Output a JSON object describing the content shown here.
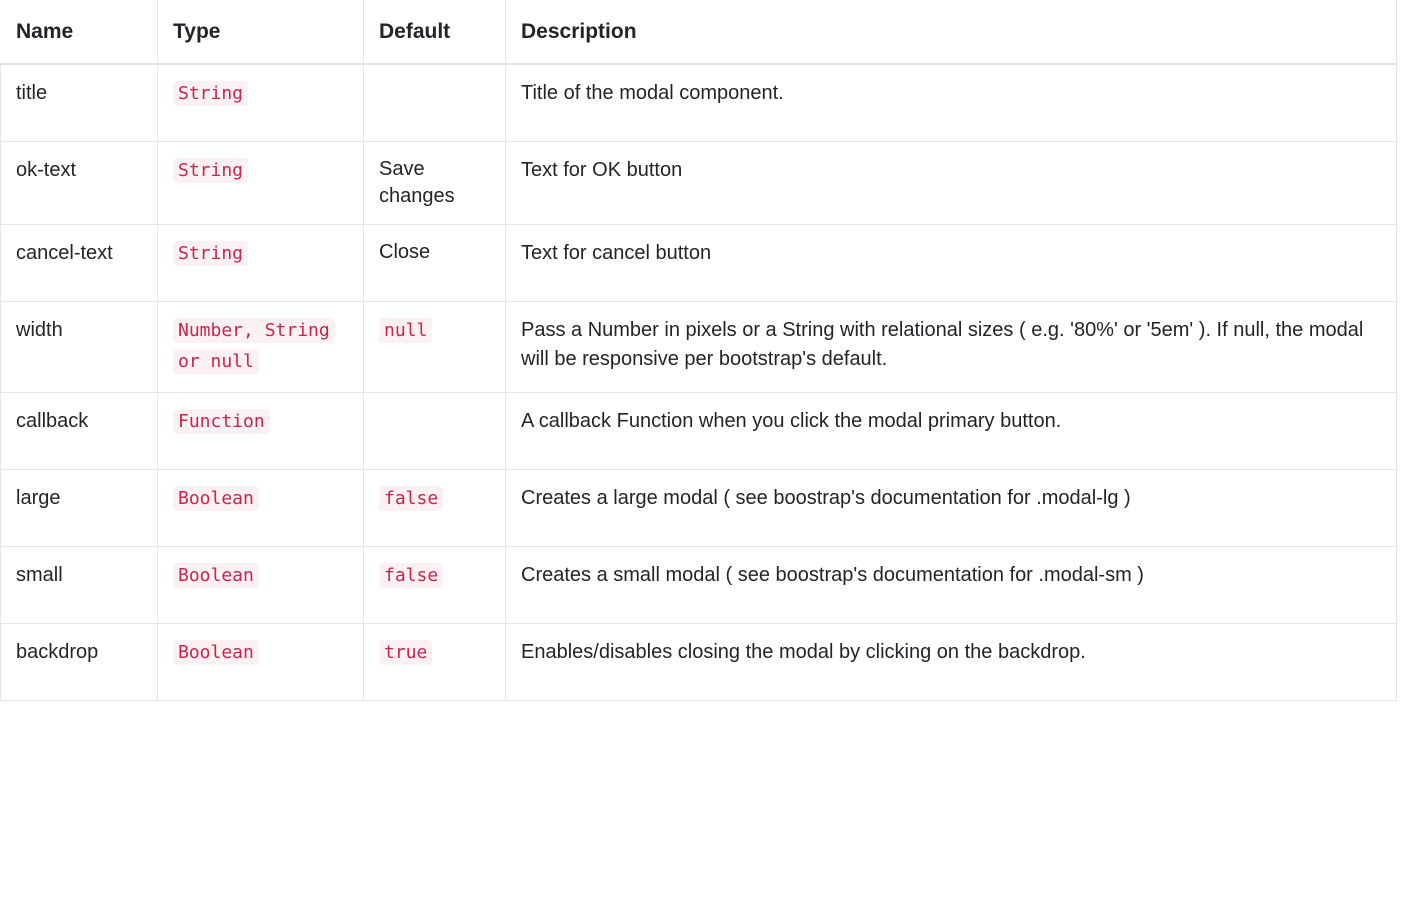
{
  "table": {
    "columns": [
      "Name",
      "Type",
      "Default",
      "Description"
    ],
    "rows": [
      {
        "name": "title",
        "type": "String",
        "default": "",
        "description": "Title of the modal component."
      },
      {
        "name": "ok-text",
        "type": "String",
        "default": "Save changes",
        "description": "Text for OK button"
      },
      {
        "name": "cancel-text",
        "type": "String",
        "default": "Close",
        "description": "Text for cancel button"
      },
      {
        "name": "width",
        "type": "Number, String or null",
        "default": "null",
        "description": "Pass a Number in pixels or a String with relational sizes ( e.g. '80%' or '5em' ). If null, the modal will be responsive per bootstrap's default."
      },
      {
        "name": "callback",
        "type": "Function",
        "default": "",
        "description": "A callback Function when you click the modal primary button."
      },
      {
        "name": "large",
        "type": "Boolean",
        "default": "false",
        "description": "Creates a large modal ( see boostrap's documentation for .modal-lg )"
      },
      {
        "name": "small",
        "type": "Boolean",
        "default": "false",
        "description": "Creates a small modal ( see boostrap's documentation for .modal-sm )"
      },
      {
        "name": "backdrop",
        "type": "Boolean",
        "default": "true",
        "description": "Enables/disables closing the modal by clicking on the backdrop."
      }
    ],
    "default_is_code": [
      false,
      false,
      false,
      true,
      false,
      true,
      true,
      true
    ],
    "colors": {
      "code_text": "#c7254e",
      "code_background": "#fbf1f3",
      "body_text": "#212529",
      "border": "#e3e5e8",
      "header_rule": "#dee2e6"
    }
  }
}
